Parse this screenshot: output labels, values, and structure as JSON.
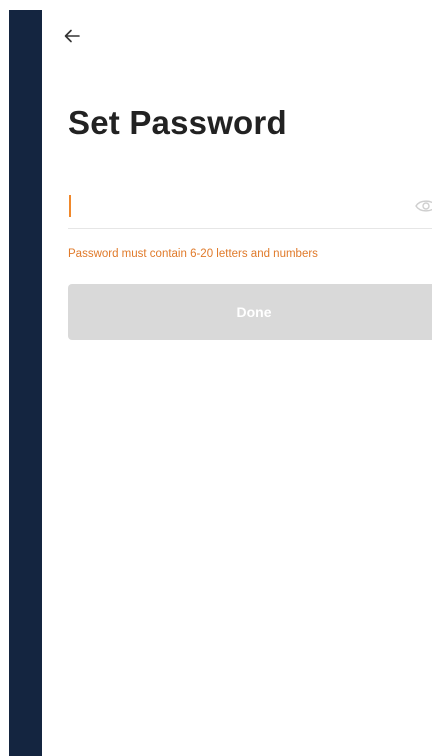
{
  "screen": {
    "title": "Set Password"
  },
  "password": {
    "value": "",
    "placeholder": "",
    "hint": "Password must contain 6-20 letters and numbers"
  },
  "actions": {
    "done_label": "Done"
  },
  "icons": {
    "back": "back-arrow-icon",
    "visibility": "eye-icon"
  },
  "colors": {
    "sidebar": "#142540",
    "accent": "#f0882b",
    "hint": "#e07a2a",
    "button_disabled": "#d9d9d9"
  }
}
